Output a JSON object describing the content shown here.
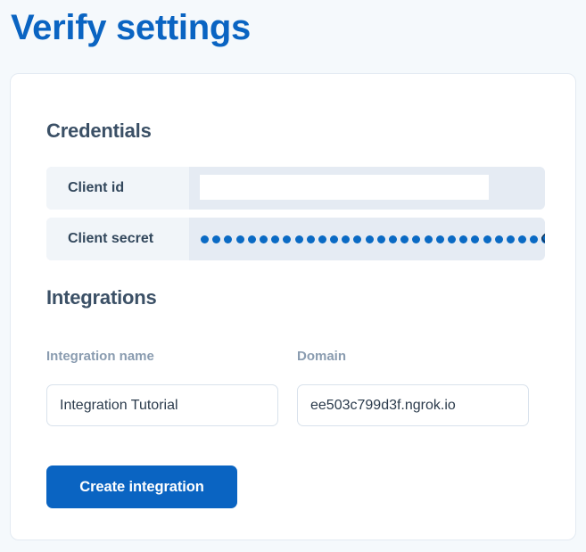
{
  "page": {
    "title": "Verify settings",
    "accent_color": "#0a64c2",
    "background_color": "#f5f9fc",
    "card_background": "#ffffff"
  },
  "credentials": {
    "heading": "Credentials",
    "rows": [
      {
        "label": "Client id",
        "value": "",
        "redacted": true,
        "has_reveal_toggle": false
      },
      {
        "label": "Client secret",
        "value": "••••••••••••••••••••••••••••••••",
        "masked": true,
        "mask_dot_count": 32,
        "mask_dot_color": "#0a6ac4",
        "has_reveal_toggle": true,
        "reveal_icon": "eye-icon"
      }
    ]
  },
  "integrations": {
    "heading": "Integrations",
    "fields": [
      {
        "label": "Integration name",
        "value": "Integration Tutorial",
        "placeholder": "Integration name"
      },
      {
        "label": "Domain",
        "value": "ee503c799d3f.ngrok.io",
        "placeholder": "Domain"
      }
    ],
    "submit_label": "Create integration"
  }
}
